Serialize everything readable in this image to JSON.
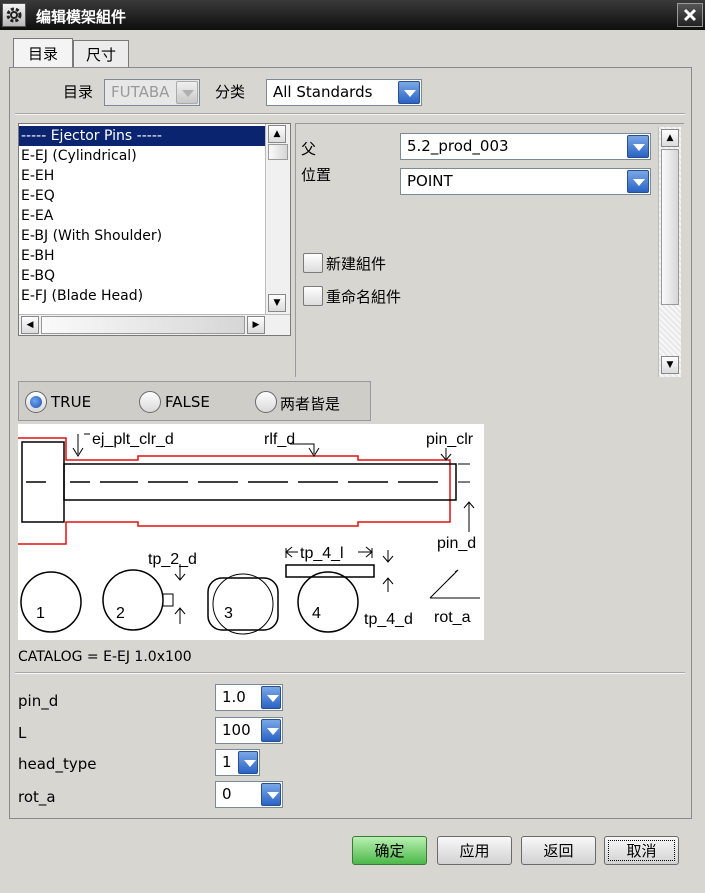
{
  "window": {
    "title": "编辑模架組件"
  },
  "tabs": [
    {
      "label": "目录"
    },
    {
      "label": "尺寸"
    }
  ],
  "catalog": {
    "label": "目录",
    "value": "FUTABA"
  },
  "category": {
    "label": "分类",
    "value": "All Standards"
  },
  "list": {
    "items": [
      "----- Ejector Pins  -----",
      "E-EJ (Cylindrical)",
      "E-EH",
      "E-EQ",
      "E-EA",
      "E-BJ (With Shoulder)",
      "E-BH",
      "E-BQ",
      "E-FJ (Blade Head)"
    ],
    "selected_index": 0
  },
  "parent": {
    "label": "父",
    "value": "5.2_prod_003"
  },
  "position": {
    "label": "位置",
    "value": "POINT"
  },
  "checkboxes": [
    {
      "label": "新建組件",
      "checked": false
    },
    {
      "label": "重命名組件",
      "checked": false
    }
  ],
  "radio": {
    "options": [
      "TRUE",
      "FALSE",
      "两者皆是"
    ],
    "selected": "TRUE"
  },
  "diagram_labels": {
    "ej_plt_clr_d": "ej_plt_clr_d",
    "rlf_d": "rlf_d",
    "pin_clr": "pin_clr",
    "pin_d": "pin_d",
    "tp_2_d": "tp_2_d",
    "tp_4_l": "tp_4_l",
    "tp_4_d": "tp_4_d",
    "rot_a": "rot_a",
    "n1": "1",
    "n2": "2",
    "n3": "3",
    "n4": "4"
  },
  "catalog_text": "CATALOG = E-EJ 1.0x100",
  "params": [
    {
      "name": "pin_d",
      "value": "1.0"
    },
    {
      "name": "L",
      "value": "100"
    },
    {
      "name": "head_type",
      "value": "1"
    },
    {
      "name": "rot_a",
      "value": "0"
    }
  ],
  "buttons": {
    "ok": "确定",
    "apply": "应用",
    "back": "返回",
    "cancel": "取消"
  },
  "colors": {
    "accent": "#2a63c4",
    "selection": "#0a2470",
    "diagram_red": "#e01010",
    "ok_green": "#4cb84a"
  }
}
